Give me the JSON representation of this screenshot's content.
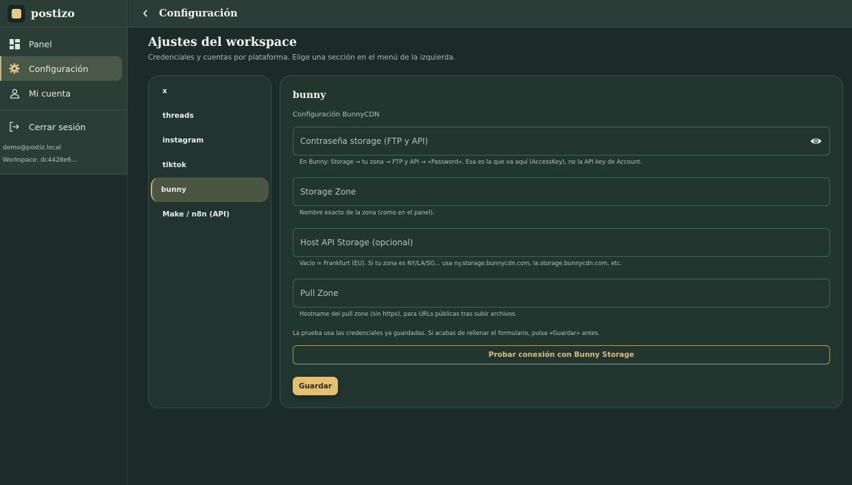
{
  "app": {
    "brand": "postizo"
  },
  "sidebar": {
    "items": [
      {
        "label": "Panel",
        "icon": "dashboard-icon"
      },
      {
        "label": "Configuración",
        "icon": "gear-icon",
        "active": true
      },
      {
        "label": "Mi cuenta",
        "icon": "user-icon"
      }
    ],
    "logout": {
      "label": "Cerrar sesión",
      "icon": "logout-icon"
    },
    "email": "demo@postiz.local",
    "workspace": "Workspace: dc4428e6..."
  },
  "topbar": {
    "title": "Configuración"
  },
  "page": {
    "title": "Ajustes del workspace",
    "subtitle": "Credenciales y cuentas por plataforma. Elige una sección en el menú de la izquierda."
  },
  "sections": [
    {
      "label": "x"
    },
    {
      "label": "threads"
    },
    {
      "label": "instagram"
    },
    {
      "label": "tiktok"
    },
    {
      "label": "bunny",
      "active": true
    },
    {
      "label": "Make / n8n (API)"
    }
  ],
  "panel": {
    "title": "bunny",
    "subtitle": "Configuración BunnyCDN",
    "fields": [
      {
        "placeholder": "Contraseña storage (FTP y API)",
        "hint": "En Bunny: Storage → tu zona → FTP y API → «Password». Esa es la que va aquí (AccessKey), no la API key de Account."
      },
      {
        "placeholder": "Storage Zone",
        "hint": "Nombre exacto de la zona (como en el panel)."
      },
      {
        "placeholder": "Host API Storage (opcional)",
        "hint": "Vacío = Frankfurt (EU). Si tu zona es NY/LA/SG... usa ny.storage.bunnycdn.com, la.storage.bunnycdn.com, etc."
      },
      {
        "placeholder": "Pull Zone",
        "hint": "Hostname del pull zone (sin https), para URLs públicas tras subir archivos."
      }
    ],
    "note": "La prueba usa las credenciales ya guardadas. Si acabas de rellenar el formulario, pulsa «Guardar» antes.",
    "test_button": "Probar conexión con Bunny Storage",
    "save_button": "Guardar"
  },
  "colors": {
    "accent": "#e3bf72",
    "background": "#1c2b27",
    "panel": "#223630"
  }
}
